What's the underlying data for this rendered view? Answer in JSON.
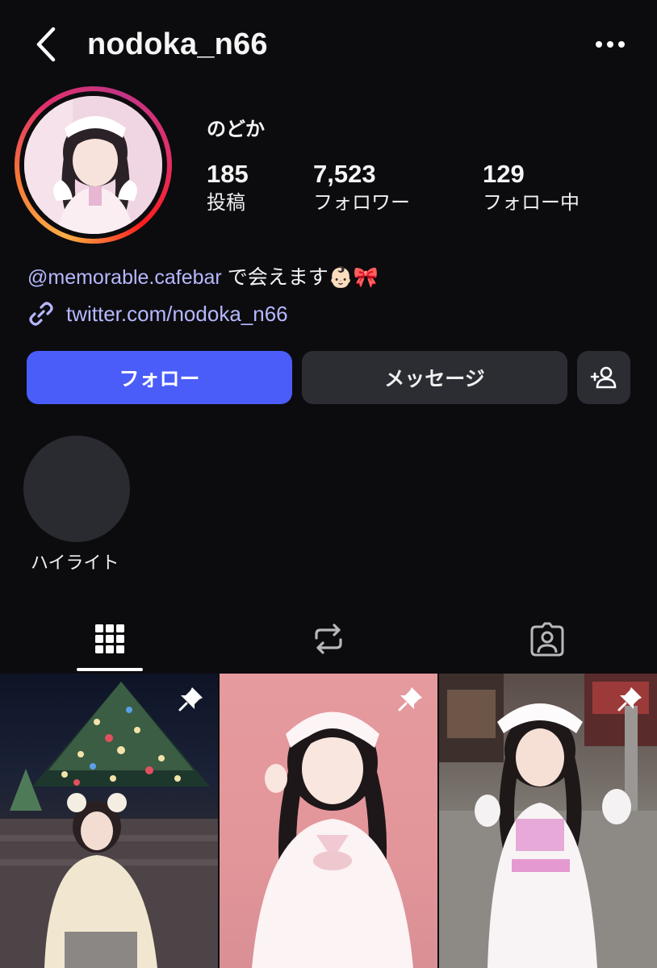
{
  "header": {
    "username": "nodoka_n66"
  },
  "profile": {
    "display_name": "のどか",
    "stats": [
      {
        "value": "185",
        "label": "投稿"
      },
      {
        "value": "7,523",
        "label": "フォロワー"
      },
      {
        "value": "129",
        "label": "フォロー中"
      }
    ],
    "bio_mention": "@memorable.cafebar",
    "bio_text": " で会えます👶🏻🎀",
    "link": "twitter.com/nodoka_n66"
  },
  "actions": {
    "follow_label": "フォロー",
    "message_label": "メッセージ"
  },
  "highlights": [
    {
      "label": "ハイライト"
    }
  ],
  "tabs": [
    {
      "icon": "grid-icon",
      "active": true
    },
    {
      "icon": "reels-repost-icon",
      "active": false
    },
    {
      "icon": "tagged-icon",
      "active": false
    }
  ],
  "posts": [
    {
      "pinned": true,
      "icon": "pin-icon"
    },
    {
      "pinned": true,
      "icon": "pin-icon"
    },
    {
      "pinned": true,
      "icon": "pin-icon"
    }
  ],
  "colors": {
    "background": "#0c0c0f",
    "follow_button": "#4a5df9",
    "secondary_button": "#2c2d33",
    "link": "#b6b8ff"
  }
}
